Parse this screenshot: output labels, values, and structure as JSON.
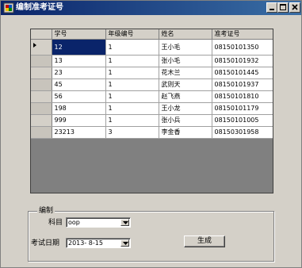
{
  "window": {
    "title": "编制准考证号"
  },
  "grid": {
    "columns": [
      "学号",
      "年级编号",
      "姓名",
      "准考证号"
    ],
    "rows": [
      [
        "12",
        "1",
        "王小毛",
        "08150101350"
      ],
      [
        "13",
        "1",
        "张小毛",
        "08150101932"
      ],
      [
        "23",
        "1",
        "花木兰",
        "08150101445"
      ],
      [
        "45",
        "1",
        "武则天",
        "08150101937"
      ],
      [
        "56",
        "1",
        "赵飞燕",
        "08150101810"
      ],
      [
        "198",
        "1",
        "王小龙",
        "08150101179"
      ],
      [
        "999",
        "1",
        "张小兵",
        "08150101005"
      ],
      [
        "23213",
        "3",
        "李金香",
        "08150301958"
      ]
    ]
  },
  "form": {
    "group_title": "编制",
    "subject_label": "科目",
    "subject_value": "oop",
    "date_label": "考试日期",
    "date_value": "2013- 8-15",
    "generate_label": "生成"
  }
}
